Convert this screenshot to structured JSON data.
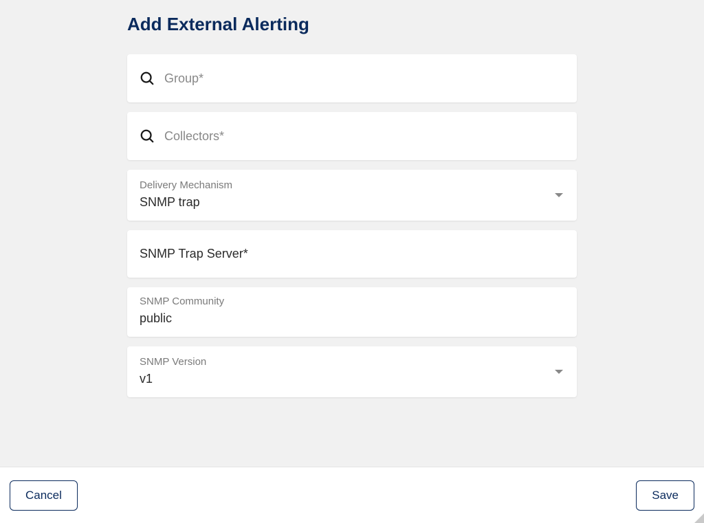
{
  "title": "Add External Alerting",
  "fields": {
    "group": {
      "placeholder": "Group*"
    },
    "collectors": {
      "placeholder": "Collectors*"
    },
    "delivery_mechanism": {
      "label": "Delivery Mechanism",
      "value": "SNMP trap"
    },
    "snmp_trap_server": {
      "label": "SNMP Trap Server*"
    },
    "snmp_community": {
      "label": "SNMP Community",
      "value": "public"
    },
    "snmp_version": {
      "label": "SNMP Version",
      "value": "v1"
    }
  },
  "footer": {
    "cancel_label": "Cancel",
    "save_label": "Save"
  }
}
